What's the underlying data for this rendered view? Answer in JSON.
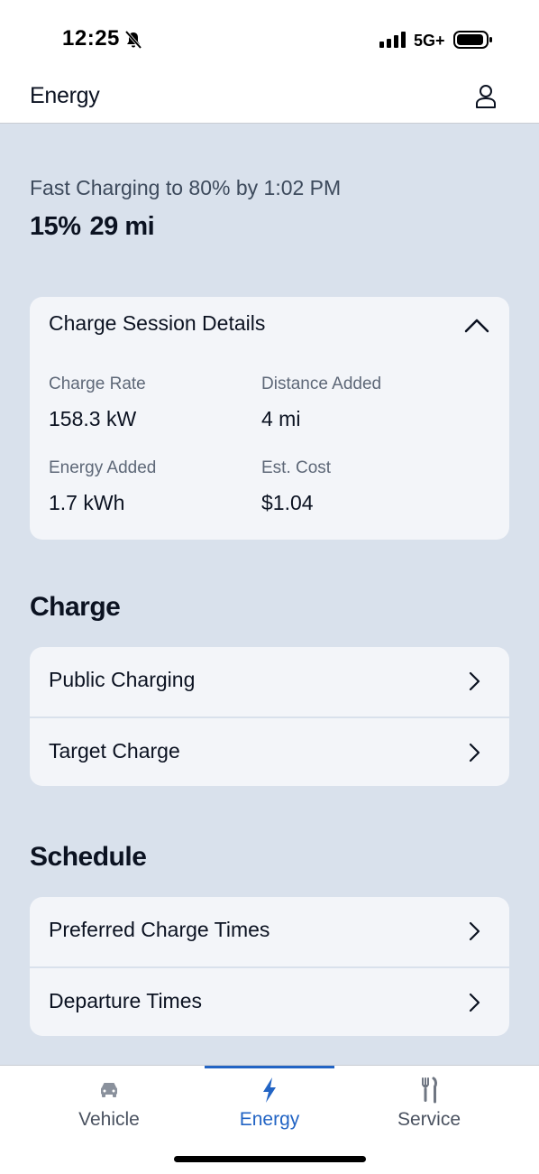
{
  "status_bar": {
    "time": "12:25",
    "network": "5G+"
  },
  "header": {
    "title": "Energy"
  },
  "charging": {
    "status": "Fast Charging to 80% by 1:02 PM",
    "percent": "15%",
    "range": "29 mi"
  },
  "session": {
    "title": "Charge Session Details",
    "stats": [
      {
        "label": "Charge Rate",
        "value": "158.3 kW"
      },
      {
        "label": "Distance Added",
        "value": "4 mi"
      },
      {
        "label": "Energy Added",
        "value": "1.7 kWh"
      },
      {
        "label": "Est. Cost",
        "value": "$1.04"
      }
    ]
  },
  "charge_section": {
    "heading": "Charge",
    "items": [
      {
        "label": "Public Charging"
      },
      {
        "label": "Target Charge"
      }
    ]
  },
  "schedule_section": {
    "heading": "Schedule",
    "items": [
      {
        "label": "Preferred Charge Times"
      },
      {
        "label": "Departure Times"
      }
    ]
  },
  "tabs": [
    {
      "label": "Vehicle",
      "icon": "car-icon"
    },
    {
      "label": "Energy",
      "icon": "lightning-icon",
      "active": true
    },
    {
      "label": "Service",
      "icon": "tools-icon"
    }
  ],
  "colors": {
    "accent": "#2264c4",
    "background": "#d9e1ec",
    "card": "#f3f5f9"
  }
}
